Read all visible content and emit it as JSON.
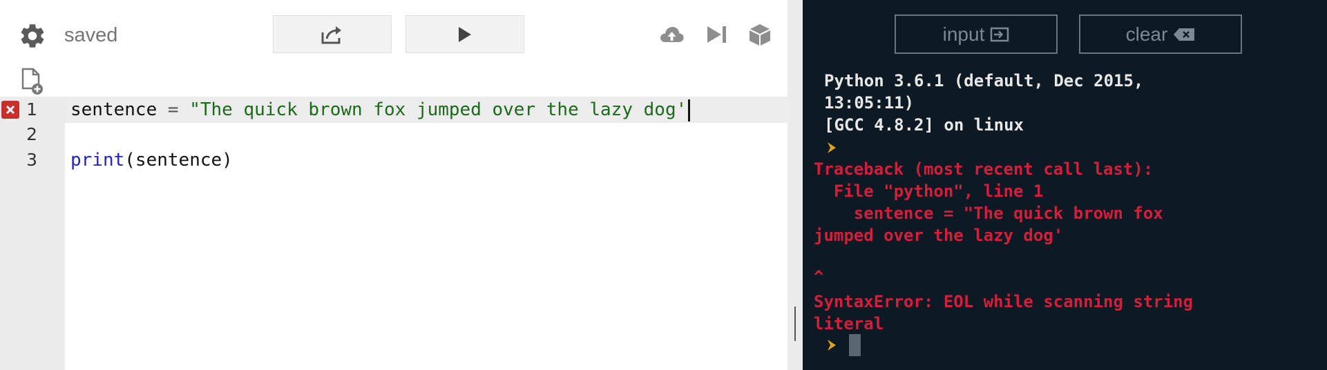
{
  "toolbar": {
    "status": "saved",
    "icons": {
      "settings": "gear-icon",
      "share": "share-icon",
      "run": "play-icon",
      "upload": "cloud-upload-icon",
      "step": "step-forward-icon",
      "package": "package-icon",
      "new_file": "new-file-icon"
    }
  },
  "editor": {
    "line_numbers": [
      "1",
      "2",
      "3"
    ],
    "error_line": 1,
    "lines": [
      {
        "parts": [
          {
            "text": "sentence"
          },
          {
            "text": " = "
          },
          {
            "text": "\"The quick brown fox jumped over the lazy dog'"
          }
        ]
      },
      {
        "parts": []
      },
      {
        "parts": [
          {
            "text": "print"
          },
          {
            "text": "(sentence)"
          }
        ]
      }
    ]
  },
  "console": {
    "input_label": "input",
    "clear_label": "clear",
    "banner": [
      "Python 3.6.1 (default, Dec 2015,",
      "13:05:11)",
      "[GCC 4.8.2] on linux"
    ],
    "error": [
      "Traceback (most recent call last):",
      "  File \"python\", line 1",
      "    sentence = \"The quick brown fox",
      "jumped over the lazy dog'",
      "^",
      "SyntaxError: EOL while scanning string",
      "literal"
    ]
  },
  "colors": {
    "console_bg": "#0d1a24",
    "error_text": "#d2203c",
    "string": "#1a6a1a",
    "keyword": "#2121c8",
    "error_marker": "#c9302c"
  }
}
